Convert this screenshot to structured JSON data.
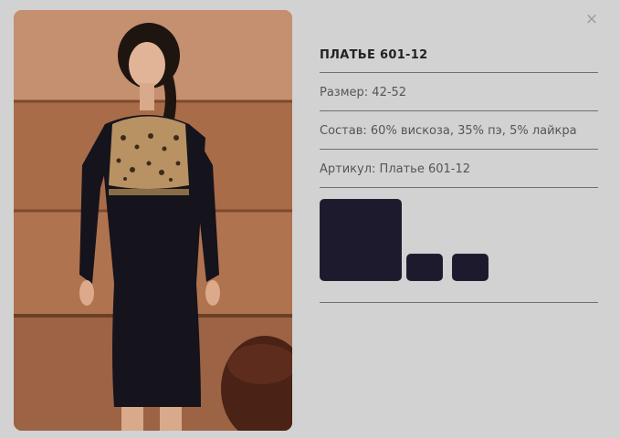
{
  "modal": {
    "close_glyph": "×"
  },
  "product": {
    "title": "ПЛАТЬЕ 601-12",
    "size_label": "Размер:",
    "size_value": "42-52",
    "composition_label": "Состав:",
    "composition_value": "60% вискоза, 35% пэ, 5% лайкра",
    "article_label": "Артикул:",
    "article_value": "Платье 601-12"
  },
  "swatches": {
    "colors": [
      "#1c1a2c",
      "#1c1a2c",
      "#1c1a2c"
    ]
  },
  "icons": {
    "close": "close-icon"
  }
}
